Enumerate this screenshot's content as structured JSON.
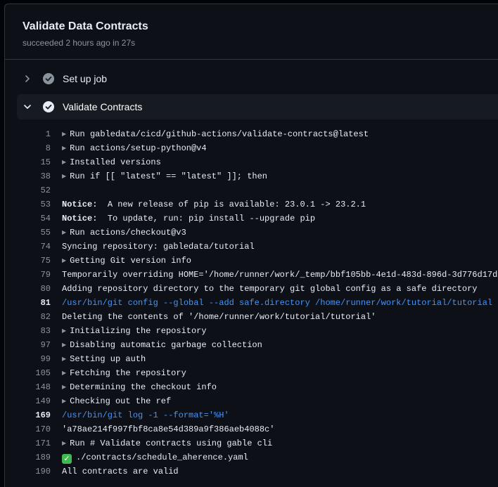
{
  "job": {
    "title": "Validate Data Contracts",
    "subtitle": "succeeded 2 hours ago in 27s"
  },
  "steps": [
    {
      "label": "Set up job",
      "state": "collapsed",
      "status_icon": "check-circle-icon"
    },
    {
      "label": "Validate Contracts",
      "state": "expanded",
      "status_icon": "check-circle-icon"
    }
  ],
  "log_lines": [
    {
      "n": "1",
      "text": "Run gabledata/cicd/github-actions/validate-contracts@latest",
      "kind": "group"
    },
    {
      "n": "8",
      "text": "Run actions/setup-python@v4",
      "kind": "group"
    },
    {
      "n": "15",
      "text": "Installed versions",
      "kind": "group"
    },
    {
      "n": "38",
      "text": "Run if [[ \"latest\" == \"latest\" ]]; then",
      "kind": "group"
    },
    {
      "n": "52",
      "text": "",
      "kind": "plain"
    },
    {
      "n": "53",
      "label": "Notice:",
      "text": "  A new release of pip is available: 23.0.1 -> 23.2.1",
      "kind": "notice"
    },
    {
      "n": "54",
      "label": "Notice:",
      "text": "  To update, run: pip install --upgrade pip",
      "kind": "notice"
    },
    {
      "n": "55",
      "text": "Run actions/checkout@v3",
      "kind": "group"
    },
    {
      "n": "74",
      "text": "Syncing repository: gabledata/tutorial",
      "kind": "plain"
    },
    {
      "n": "75",
      "text": "Getting Git version info",
      "kind": "group"
    },
    {
      "n": "79",
      "text": "Temporarily overriding HOME='/home/runner/work/_temp/bbf105bb-4e1d-483d-896d-3d776d17d",
      "kind": "plain"
    },
    {
      "n": "80",
      "text": "Adding repository directory to the temporary git global config as a safe directory",
      "kind": "plain"
    },
    {
      "n": "81",
      "text": "/usr/bin/git config --global --add safe.directory /home/runner/work/tutorial/tutorial",
      "kind": "cmd"
    },
    {
      "n": "82",
      "text": "Deleting the contents of '/home/runner/work/tutorial/tutorial'",
      "kind": "plain"
    },
    {
      "n": "83",
      "text": "Initializing the repository",
      "kind": "group"
    },
    {
      "n": "97",
      "text": "Disabling automatic garbage collection",
      "kind": "group"
    },
    {
      "n": "99",
      "text": "Setting up auth",
      "kind": "group"
    },
    {
      "n": "105",
      "text": "Fetching the repository",
      "kind": "group"
    },
    {
      "n": "148",
      "text": "Determining the checkout info",
      "kind": "group"
    },
    {
      "n": "149",
      "text": "Checking out the ref",
      "kind": "group"
    },
    {
      "n": "169",
      "text": "/usr/bin/git log -1 --format='%H'",
      "kind": "cmd"
    },
    {
      "n": "170",
      "text": "'a78ae214f997fbf8ca8e54d389a9f386aeb4088c'",
      "kind": "plain"
    },
    {
      "n": "171",
      "text": "Run # Validate contracts using gable cli",
      "kind": "group"
    },
    {
      "n": "189",
      "text": "./contracts/schedule_aherence.yaml",
      "kind": "check"
    },
    {
      "n": "190",
      "text": "All contracts are valid",
      "kind": "plain"
    }
  ],
  "colors": {
    "background": "#0d1117",
    "text": "#e6edf3",
    "muted": "#8b949e",
    "command": "#4493f8",
    "success": "#3fb950"
  }
}
